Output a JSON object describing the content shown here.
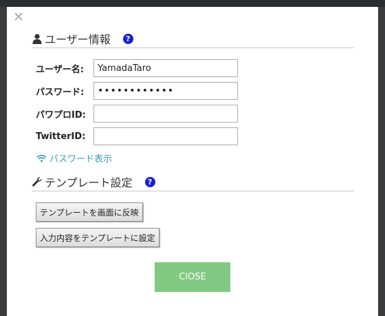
{
  "dialog": {
    "close_icon": "✕",
    "user_section": {
      "title": "ユーザー情報",
      "help": "?",
      "icon": "user-icon",
      "fields": [
        {
          "label": "ユーザー名:",
          "value": "YamadaTaro",
          "type": "text"
        },
        {
          "label": "パスワード:",
          "value": "••••••••••••",
          "type": "password"
        },
        {
          "label": "パワプロID:",
          "value": "",
          "type": "text"
        },
        {
          "label": "TwitterID:",
          "value": "",
          "type": "text"
        }
      ],
      "show_password": "パスワード表示"
    },
    "template_section": {
      "title": "テンプレート設定",
      "help": "?",
      "icon": "wrench-icon",
      "apply_button": "テンプレートを画面に反映",
      "set_button": "入力内容をテンプレートに設定"
    },
    "close_button": "ClOSE",
    "colors": {
      "help_icon": "#1a1ed8",
      "show_password_link": "#3aa0b0",
      "close_button_bg": "#82c983"
    }
  }
}
